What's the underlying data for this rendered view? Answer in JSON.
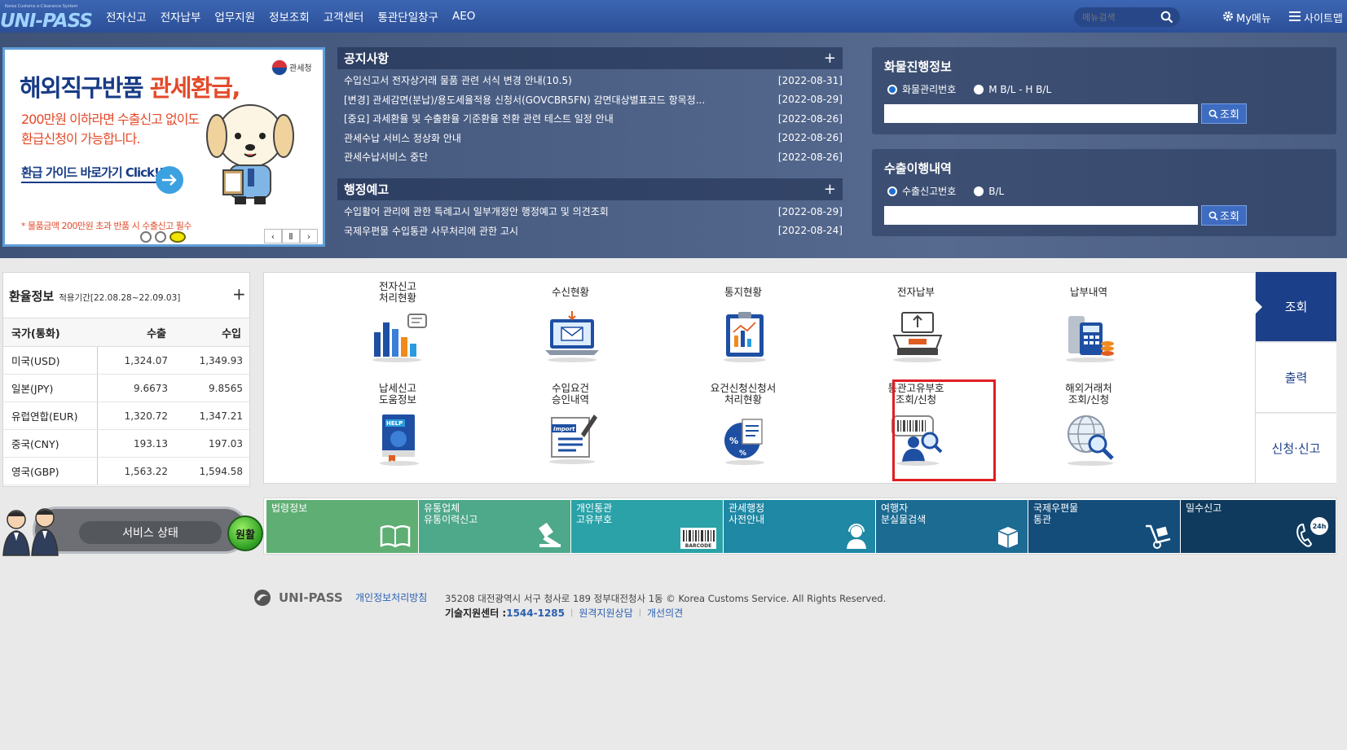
{
  "header": {
    "logo_tag": "Korea Customs e-Clearance System",
    "logo_text": "UNI-PASS",
    "menu": [
      "전자신고",
      "전자납부",
      "업무지원",
      "정보조회",
      "고객센터",
      "통관단일창구",
      "AEO"
    ],
    "search_placeholder": "메뉴검색",
    "my_menu": "My메뉴",
    "sitemap": "사이트맵"
  },
  "banner": {
    "headline_a": "해외직구반품 ",
    "headline_b": "관세환급,",
    "line2": "200만원 이하라면 수출신고 없이도",
    "line3": "환급신청이 가능합니다.",
    "guide": "환급 가이드 바로가기 Click!!",
    "note": "* 물품금액 200만원 초과 반품 시 수출신고 필수",
    "agency": "관세청",
    "control_prev": "‹",
    "control_pause": "Ⅱ",
    "control_next": "›"
  },
  "notices": {
    "title": "공지사항",
    "plus": "+",
    "items": [
      {
        "text": "수입신고서 전자상거래 물품 관련 서식 변경 안내(10.5)",
        "date": "[2022-08-31]"
      },
      {
        "text": "[변경] 관세감면(분납)/용도세율적용 신청서(GOVCBR5FN) 감면대상별표코드 항목정...",
        "date": "[2022-08-29]"
      },
      {
        "text": "[중요] 과세환율 및 수출환율 기준환율 전환 관련 테스트 일정 안내",
        "date": "[2022-08-26]"
      },
      {
        "text": "관세수납 서비스 정상화 안내",
        "date": "[2022-08-26]"
      },
      {
        "text": "관세수납서비스 중단",
        "date": "[2022-08-26]"
      }
    ]
  },
  "admin_notices": {
    "title": "행정예고",
    "plus": "+",
    "items": [
      {
        "text": "수입활어 관리에 관한 특례고시 일부개정안 행정예고 및 의견조회",
        "date": "[2022-08-29]"
      },
      {
        "text": "국제우편물 수입통관 사무처리에 관한 고시",
        "date": "[2022-08-24]"
      }
    ]
  },
  "cargo": {
    "title": "화물진행정보",
    "option1": "화물관리번호",
    "option2": "M B/L - H B/L",
    "button": "조회"
  },
  "export_hist": {
    "title": "수출이행내역",
    "option1": "수출신고번호",
    "option2": "B/L",
    "button": "조회"
  },
  "exchange": {
    "title": "환율정보",
    "period": "적용기간[22.08.28~22.09.03]",
    "plus": "+",
    "headers": [
      "국가(통화)",
      "수출",
      "수입"
    ],
    "rows": [
      {
        "country": "미국(USD)",
        "export": "1,324.07",
        "import": "1,349.93"
      },
      {
        "country": "일본(JPY)",
        "export": "9.6673",
        "import": "9.8565"
      },
      {
        "country": "유럽연합(EUR)",
        "export": "1,320.72",
        "import": "1,347.21"
      },
      {
        "country": "중국(CNY)",
        "export": "193.13",
        "import": "197.03"
      },
      {
        "country": "영국(GBP)",
        "export": "1,563.22",
        "import": "1,594.58"
      }
    ]
  },
  "service_status": {
    "label": "서비스 상태",
    "status": "원활"
  },
  "services": {
    "row1": [
      {
        "l1": "전자신고",
        "l2": "처리현황"
      },
      {
        "l1": "수신현황",
        "l2": ""
      },
      {
        "l1": "통지현황",
        "l2": ""
      },
      {
        "l1": "전자납부",
        "l2": ""
      },
      {
        "l1": "납부내역",
        "l2": ""
      }
    ],
    "row2": [
      {
        "l1": "납세신고",
        "l2": "도움정보"
      },
      {
        "l1": "수입요건",
        "l2": "승인내역"
      },
      {
        "l1": "요건신청신청서",
        "l2": "처리현황"
      },
      {
        "l1": "통관고유부호",
        "l2": "조회/신청"
      },
      {
        "l1": "해외거래처",
        "l2": "조회/신청"
      }
    ],
    "icon_text_help": "HELP",
    "icon_text_import": "Import"
  },
  "tabs": [
    "조회",
    "출력",
    "신청·신고"
  ],
  "quicklinks": [
    {
      "l1": "법령정보",
      "l2": "",
      "color": "#5fae73"
    },
    {
      "l1": "유통업체",
      "l2": "유통이력신고",
      "color": "#4ea88a"
    },
    {
      "l1": "개인통관",
      "l2": "고유부호",
      "color": "#2aa2a7"
    },
    {
      "l1": "관세행정",
      "l2": "사전안내",
      "color": "#1f88a4"
    },
    {
      "l1": "여행자",
      "l2": "분실물검색",
      "color": "#1c6b92"
    },
    {
      "l1": "국제우편물",
      "l2": "통관",
      "color": "#144d7a"
    },
    {
      "l1": "밀수신고",
      "l2": "",
      "color": "#0f3a5e"
    }
  ],
  "quick_icon_text": {
    "barcode": "BARCODE",
    "hours": "24h"
  },
  "footer": {
    "logo": "UNI-PASS",
    "privacy": "개인정보처리방침",
    "address": "35208 대전광역시 서구 청사로 189 정부대전청사 1동 © Korea Customs Service. All Rights Reserved.",
    "tech_label": "기술지원센터 : ",
    "tech_phone": "1544-1285",
    "remote": "원격지원상담",
    "feedback": "개선의견"
  }
}
